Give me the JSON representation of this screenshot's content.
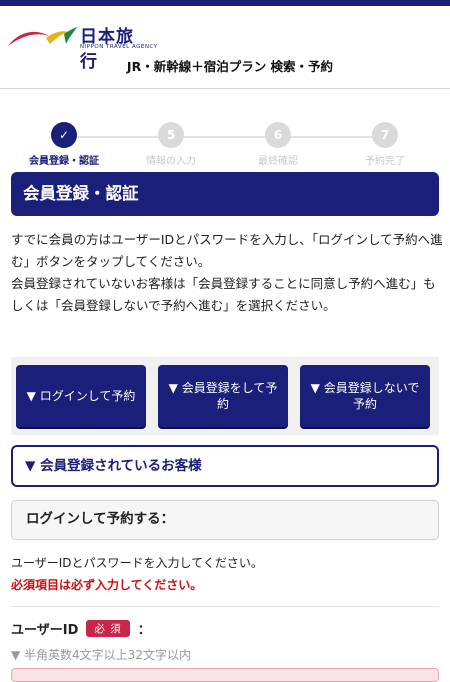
{
  "header": {
    "logo_text": "日本旅行",
    "logo_subtitle": "NIPPON TRAVEL AGENCY",
    "site_title": "JR・新幹線＋宿泊プラン 検索・予約"
  },
  "steps": [
    {
      "label": "会員登録・認証",
      "number": "✓",
      "active": true
    },
    {
      "label": "情報の入力",
      "number": "5",
      "active": false
    },
    {
      "label": "最終確認",
      "number": "6",
      "active": false
    },
    {
      "label": "予約完了",
      "number": "7",
      "active": false
    }
  ],
  "section_title": "会員登録・認証",
  "intro": {
    "paragraph1": "すでに会員の方はユーザーIDとパスワードを入力し、「ログインして予約へ進む」ボタンをタップしてください。",
    "paragraph2": "会員登録されていないお客様は「会員登録することに同意し予約へ進む」もしくは「会員登録しないで予約へ進む」を選択ください。"
  },
  "nav_buttons": [
    {
      "label": "▼ ログインして予約"
    },
    {
      "label": "▼ 会員登録をして予約"
    },
    {
      "label": "▼ 会員登録しないで予約"
    }
  ],
  "member_section": {
    "title": "▼ 会員登録されているお客様"
  },
  "login_box": {
    "title": "ログインして予約する："
  },
  "instruction": "ユーザーIDとパスワードを入力してください。",
  "required_note": "必須項目は必ず入力してください。",
  "user_id_field": {
    "label": "ユーザーID",
    "badge": "必 須",
    "colon": "：",
    "hint": "▼ 半角英数4文字以上32文字以内"
  },
  "colors": {
    "brand": "#1a1f7a",
    "required": "#cc1010",
    "badge": "#c8264a"
  }
}
